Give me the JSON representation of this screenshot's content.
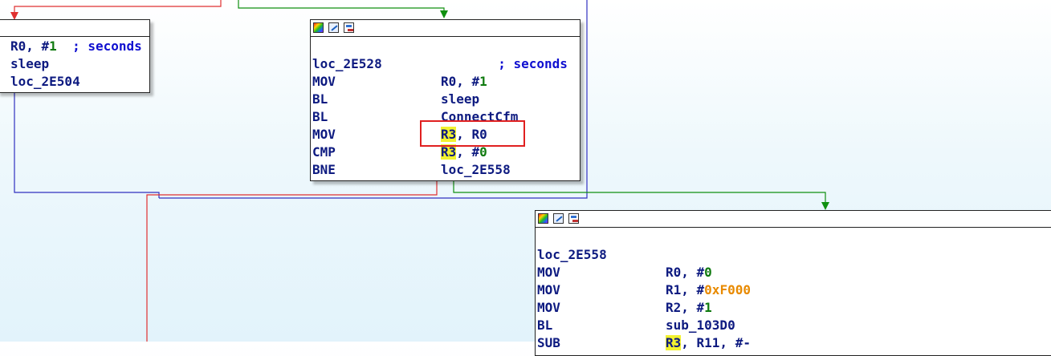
{
  "node_left": {
    "lines": [
      {
        "mnemonic": "",
        "op_reg": "R0",
        "op_sep": ", #",
        "op_num": "1",
        "comment": "; seconds"
      },
      {
        "mnemonic": "",
        "op_text": "sleep"
      },
      {
        "mnemonic": "",
        "op_text": "loc_2E504"
      }
    ]
  },
  "node_center": {
    "label": "loc_2E528",
    "label_comment": "; seconds",
    "lines": [
      {
        "mnemonic": "MOV",
        "op_reg": "R0",
        "op_sep": ", #",
        "op_num": "1"
      },
      {
        "mnemonic": "BL",
        "op_text": "sleep"
      },
      {
        "mnemonic": "BL",
        "op_text": "ConnectCfm"
      },
      {
        "mnemonic": "MOV",
        "op_reg_hl": "R3",
        "op_rest": ", R0"
      },
      {
        "mnemonic": "CMP",
        "op_reg_hl": "R3",
        "op_sep": ", #",
        "op_num": "0"
      },
      {
        "mnemonic": "BNE",
        "op_text": "loc_2E558"
      }
    ]
  },
  "node_right": {
    "label": "loc_2E558",
    "lines": [
      {
        "mnemonic": "MOV",
        "op_reg": "R0",
        "op_sep": ", #",
        "op_num": "0"
      },
      {
        "mnemonic": "MOV",
        "op_reg": "R1",
        "op_sep": ", #",
        "op_hex": "0xF000"
      },
      {
        "mnemonic": "MOV",
        "op_reg": "R2",
        "op_sep": ", #",
        "op_num": "1"
      },
      {
        "mnemonic": "BL",
        "op_text": "sub_103D0"
      },
      {
        "mnemonic": "SUB",
        "op_reg_hl": "R3",
        "op_rest": ", R11, #-"
      }
    ]
  },
  "colors": {
    "edge_false": "#e03030",
    "edge_true": "#109010",
    "edge_uncond": "#3030c0",
    "highlight": "#f2f230",
    "annotation_box": "#e02020"
  }
}
